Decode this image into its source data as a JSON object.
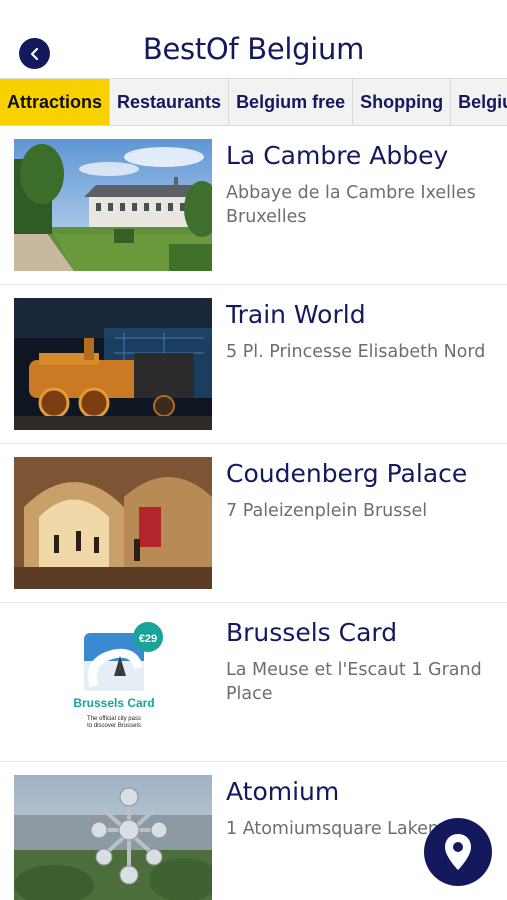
{
  "header": {
    "title": "BestOf Belgium",
    "back_icon": "chevron-left-icon"
  },
  "tabs": [
    {
      "label": "Attractions",
      "active": true
    },
    {
      "label": "Restaurants",
      "active": false
    },
    {
      "label": "Belgium free",
      "active": false
    },
    {
      "label": "Shopping",
      "active": false
    },
    {
      "label": "Belgiu",
      "active": false
    }
  ],
  "items": [
    {
      "name": "La Cambre Abbey",
      "address": "Abbaye de la Cambre Ixelles Bruxelles"
    },
    {
      "name": "Train World",
      "address": "5 Pl. Princesse Elisabeth Nord"
    },
    {
      "name": "Coudenberg Palace",
      "address": "7 Paleizenplein Brussel"
    },
    {
      "name": "Brussels Card",
      "address": "La Meuse et l'Escaut 1 Grand Place",
      "card": {
        "price": "€29",
        "brand": "Brussels Card",
        "tagline_1": "The official city pass",
        "tagline_2": "to discover Brussels"
      }
    },
    {
      "name": "Atomium",
      "address": "1 Atomiumsquare Laken"
    }
  ],
  "fab": {
    "icon": "map-pin-icon"
  },
  "colors": {
    "navy": "#14195e",
    "accent": "#f9d000",
    "teal": "#1aa39a"
  }
}
